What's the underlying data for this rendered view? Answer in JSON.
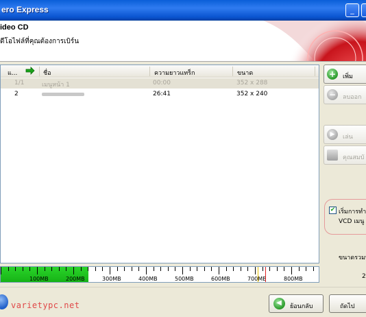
{
  "window": {
    "title": "ero Express",
    "buttons": {
      "minimize": "_",
      "maximize": "□"
    }
  },
  "header": {
    "title": "ideo CD",
    "subtitle": "ิดีโอไฟล์ที่คุณต้องการเบิร์น"
  },
  "list": {
    "columns": [
      "แ...",
      "ชื่อ",
      "ความยาวแทร็ก",
      "ขนาด"
    ],
    "rows": [
      {
        "index": "1/1",
        "name": "เมนูหน้า 1",
        "length": "00:00",
        "size": "352 x 288",
        "selected": true
      },
      {
        "index": "2",
        "name": "",
        "length": "26:41",
        "size": "352 x 240",
        "selected": false
      }
    ]
  },
  "sidebar": {
    "add": "เพิ่ม",
    "remove": "ลบออก",
    "play": "เล่น",
    "properties": "คุณสมบั",
    "vcd_line1": "เริ่มการทำง",
    "vcd_line2": "VCD เมนู",
    "vcd_checked": "✔",
    "total_label": "ขนาดรวมบ",
    "total_value": "2"
  },
  "capacity": {
    "fill_fraction": 0.275,
    "labels": [
      "100MB",
      "200MB",
      "300MB",
      "400MB",
      "500MB",
      "600MB",
      "700MB",
      "800MB"
    ],
    "colors": {
      "fill": "#16b316",
      "limit_yellow": "#e8c000",
      "limit_red": "#e02020"
    }
  },
  "footer": {
    "watermark": "varietypc.net",
    "back": "ย้อนกลับ",
    "next": "ถัดไป"
  }
}
